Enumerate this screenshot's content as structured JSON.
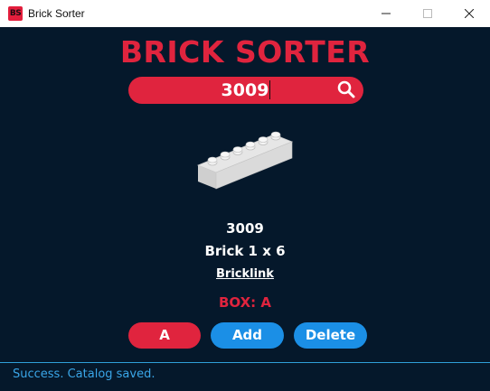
{
  "window": {
    "app_icon_text": "BS",
    "title": "Brick Sorter"
  },
  "heading": "BRICK SORTER",
  "search": {
    "value": "3009"
  },
  "part": {
    "number": "3009",
    "name": "Brick 1 x 6",
    "link_label": "Bricklink",
    "box_label": "BOX: A"
  },
  "actions": {
    "box_button_label": "A",
    "add_label": "Add",
    "delete_label": "Delete"
  },
  "status": "Success. Catalog saved.",
  "colors": {
    "background": "#05182b",
    "accent_red": "#e0243e",
    "accent_blue": "#1b8fe6",
    "status_text": "#3aa6e8"
  },
  "icons": [
    "app-icon",
    "minimize-icon",
    "maximize-icon",
    "close-icon",
    "search-icon",
    "brick-image"
  ]
}
